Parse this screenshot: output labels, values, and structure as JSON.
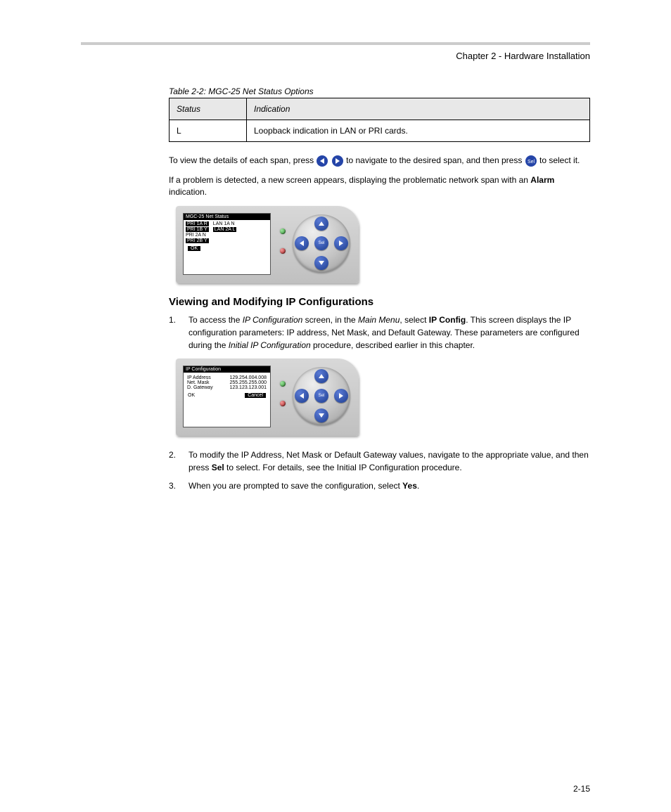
{
  "header": "Chapter 2 - Hardware Installation",
  "table": {
    "caption": "Table 2-2: MGC-25 Net Status Options",
    "col1": "Status",
    "col2": "Indication",
    "row_status": "L",
    "row_indication": "Loopback indication in LAN or PRI cards."
  },
  "para1": "To view the details of each span, press ",
  "para1b": " to navigate to the desired span, and then press ",
  "para1c": " to select it.",
  "para2_pre": "If a problem is detected, a new screen appears, displaying the problematic network span with an ",
  "para2_bold": "Alarm",
  "para2_post": " indication.",
  "lcd1": {
    "title": "MGC-25 Net Status",
    "col_left": [
      "PRI 1A  R",
      "PRI 1B  Y",
      "PRI 2A  N",
      "PRI 2B  Y"
    ],
    "col_right": [
      "LAN 1A  N",
      "LAN  2A L"
    ],
    "ok": "OK"
  },
  "heading": "Viewing and Modifying IP Configurations",
  "step1_num": "1.",
  "step1_pre": "To access the ",
  "step1_em1": "IP Configuration",
  "step1_mid": " screen, in the ",
  "step1_em2": "Main Menu",
  "step1_post": ", select ",
  "step1_bold": "IP Config",
  "step1_end": ".\n\nThis screen displays the IP configuration parameters: IP address, Net Mask, and Default Gateway. These parameters are configured during the ",
  "step1_em3": "Initial IP Configuration",
  "step1_tail": " procedure, described earlier in this chapter.",
  "lcd2": {
    "title": "IP Configuration",
    "rows": [
      {
        "k": "IP Address",
        "v": "129.254.004.008"
      },
      {
        "k": "Net. Mask",
        "v": "255.255.255.000"
      },
      {
        "k": "D. Gateway",
        "v": "123.123.123.001"
      }
    ],
    "ok": "OK",
    "cancel": "Cancel"
  },
  "step2_num": "2.",
  "step2_pre": "To modify the IP Address, Net Mask or Default Gateway values, navigate to the appropriate value, and then press ",
  "step2_bold": "Sel",
  "step2_tail": " to select. For details, see the Initial IP Configuration procedure.",
  "step3_num": "3.",
  "step3_pre": "When you are prompted to save the configuration, select ",
  "step3_bold": "Yes",
  "step3_tail": ".",
  "footer": "2-15"
}
